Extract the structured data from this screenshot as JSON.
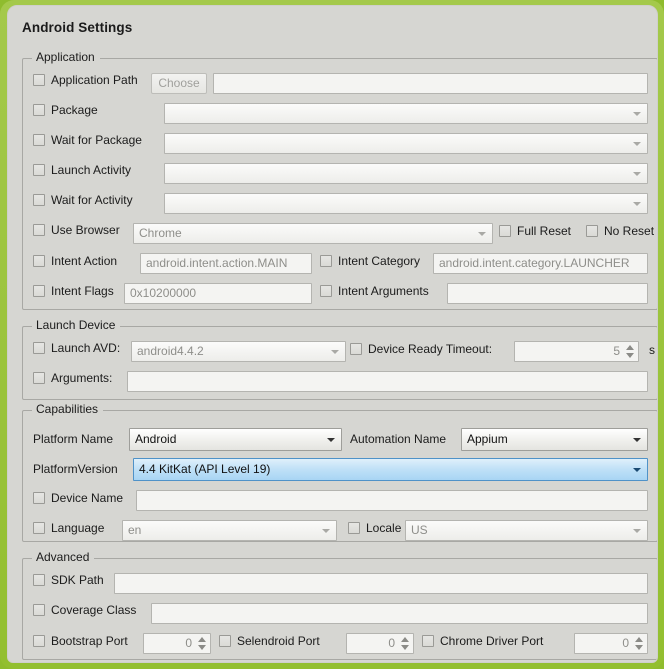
{
  "window": {
    "title": "Android Settings"
  },
  "groups": {
    "application": {
      "legend": "Application",
      "application_path": {
        "label": "Application Path",
        "choose_button": "Choose",
        "value": ""
      },
      "package": {
        "label": "Package",
        "value": ""
      },
      "wait_for_package": {
        "label": "Wait for Package",
        "value": ""
      },
      "launch_activity": {
        "label": "Launch Activity",
        "value": ""
      },
      "wait_for_activity": {
        "label": "Wait for Activity",
        "value": ""
      },
      "use_browser": {
        "label": "Use Browser",
        "value": "Chrome"
      },
      "full_reset": {
        "label": "Full Reset"
      },
      "no_reset": {
        "label": "No Reset"
      },
      "intent_action": {
        "label": "Intent Action",
        "value": "android.intent.action.MAIN"
      },
      "intent_category": {
        "label": "Intent Category",
        "value": "android.intent.category.LAUNCHER"
      },
      "intent_flags": {
        "label": "Intent Flags",
        "value": "0x10200000"
      },
      "intent_arguments": {
        "label": "Intent Arguments",
        "value": ""
      }
    },
    "launch_device": {
      "legend": "Launch Device",
      "launch_avd": {
        "label": "Launch AVD:",
        "value": "android4.4.2"
      },
      "device_ready_timeout": {
        "label": "Device Ready Timeout:",
        "value": "5",
        "unit": "s"
      },
      "arguments": {
        "label": "Arguments:",
        "value": ""
      }
    },
    "capabilities": {
      "legend": "Capabilities",
      "platform_name": {
        "label": "Platform Name",
        "value": "Android"
      },
      "automation_name": {
        "label": "Automation Name",
        "value": "Appium"
      },
      "platform_version": {
        "label": "PlatformVersion",
        "value": "4.4 KitKat (API Level 19)"
      },
      "device_name": {
        "label": "Device Name",
        "value": ""
      },
      "language": {
        "label": "Language",
        "value": "en"
      },
      "locale": {
        "label": "Locale",
        "value": "US"
      }
    },
    "advanced": {
      "legend": "Advanced",
      "sdk_path": {
        "label": "SDK Path",
        "value": ""
      },
      "coverage_class": {
        "label": "Coverage Class",
        "value": ""
      },
      "bootstrap_port": {
        "label": "Bootstrap Port",
        "value": "0"
      },
      "selendroid_port": {
        "label": "Selendroid Port",
        "value": "0"
      },
      "chrome_driver_port": {
        "label": "Chrome Driver Port",
        "value": "0"
      }
    }
  },
  "colors": {
    "frame_green": "#93bf30",
    "dialog_bg": "#d6d6d2",
    "selected_combo_border": "#4f92c8",
    "selected_combo_bg": "#bfe0f7"
  }
}
